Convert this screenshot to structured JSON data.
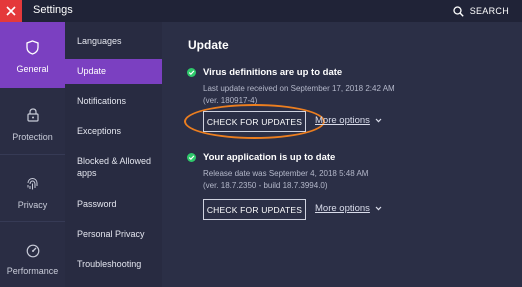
{
  "window": {
    "title": "Settings",
    "search_label": "SEARCH"
  },
  "nav": {
    "items": [
      {
        "label": "General",
        "icon": "shield-icon",
        "active": true
      },
      {
        "label": "Protection",
        "icon": "lock-icon",
        "active": false
      },
      {
        "label": "Privacy",
        "icon": "fingerprint-icon",
        "active": false
      },
      {
        "label": "Performance",
        "icon": "gauge-icon",
        "active": false
      }
    ]
  },
  "submenu": {
    "items": [
      {
        "label": "Languages",
        "active": false
      },
      {
        "label": "Update",
        "active": true
      },
      {
        "label": "Notifications",
        "active": false
      },
      {
        "label": "Exceptions",
        "active": false
      },
      {
        "label": "Blocked & Allowed apps",
        "active": false
      },
      {
        "label": "Password",
        "active": false
      },
      {
        "label": "Personal Privacy",
        "active": false
      },
      {
        "label": "Troubleshooting",
        "active": false
      }
    ]
  },
  "main": {
    "heading": "Update",
    "sections": [
      {
        "title": "Virus definitions are up to date",
        "detail_line1": "Last update received on September 17, 2018 2:42 AM",
        "detail_line2": "(ver. 180917-4)",
        "button_label": "CHECK FOR UPDATES",
        "more_label": "More options"
      },
      {
        "title": "Your application is up to date",
        "detail_line1": "Release date was September 4, 2018 5:48 AM",
        "detail_line2": "(ver. 18.7.2350 - build 18.7.3994.0)",
        "button_label": "CHECK FOR UPDATES",
        "more_label": "More options"
      }
    ]
  },
  "colors": {
    "accent": "#7b40c1",
    "close": "#e4393b",
    "success": "#2fc96b",
    "highlight": "#ec7e1f"
  }
}
